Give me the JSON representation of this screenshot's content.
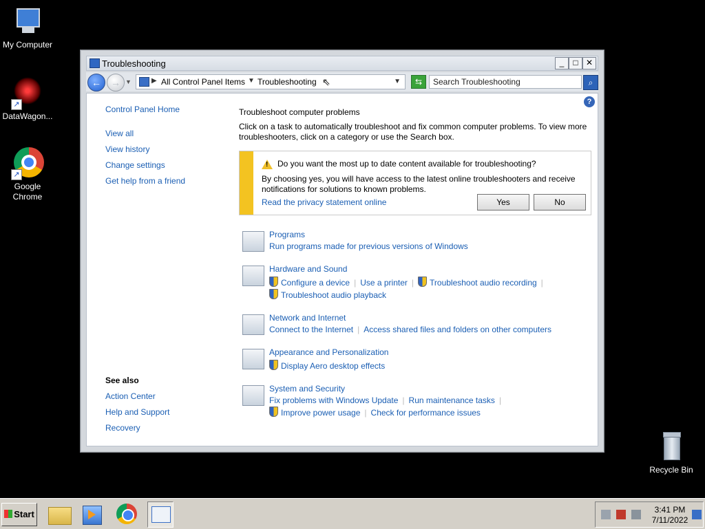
{
  "desktop": {
    "icons": [
      {
        "label": "My Computer"
      },
      {
        "label": "DataWagon..."
      },
      {
        "label": "Google Chrome"
      },
      {
        "label": "Recycle Bin"
      }
    ]
  },
  "window": {
    "title": "Troubleshooting",
    "controls": {
      "minimize": "_",
      "maximize": "□",
      "close": "✕"
    },
    "breadcrumb": [
      "All Control Panel Items",
      "Troubleshooting"
    ],
    "search_placeholder": "Search Troubleshooting",
    "left_nav": {
      "items": [
        "Control Panel Home",
        "View all",
        "View history",
        "Change settings",
        "Get help from a friend"
      ],
      "see_also_heading": "See also",
      "see_also": [
        "Action Center",
        "Help and Support",
        "Recovery"
      ]
    },
    "main": {
      "heading": "Troubleshoot computer problems",
      "description": "Click on a task to automatically troubleshoot and fix common computer problems. To view more troubleshooters, click on a category or use the Search box.",
      "infobar": {
        "question": "Do you want the most up to date content available for troubleshooting?",
        "body": "By choosing yes, you will have access to the latest online troubleshooters and receive notifications for solutions to known problems.",
        "privacy_link": "Read the privacy statement online",
        "yes_label": "Yes",
        "no_label": "No"
      },
      "categories": [
        {
          "title": "Programs",
          "links": [
            "Run programs made for previous versions of Windows"
          ]
        },
        {
          "title": "Hardware and Sound",
          "links": [
            "Configure a device",
            "Use a printer",
            "Troubleshoot audio recording",
            "Troubleshoot audio playback"
          ]
        },
        {
          "title": "Network and Internet",
          "links": [
            "Connect to the Internet",
            "Access shared files and folders on other computers"
          ]
        },
        {
          "title": "Appearance and Personalization",
          "links": [
            "Display Aero desktop effects"
          ]
        },
        {
          "title": "System and Security",
          "links": [
            "Fix problems with Windows Update",
            "Run maintenance tasks",
            "Improve power usage",
            "Check for performance issues"
          ]
        }
      ]
    }
  },
  "taskbar": {
    "start_label": "Start",
    "clock_time": "3:41 PM",
    "clock_date": "7/11/2022"
  },
  "icons": {
    "help": "?",
    "back": "←",
    "forward": "→",
    "search": "⌕",
    "refresh": "⇆"
  }
}
